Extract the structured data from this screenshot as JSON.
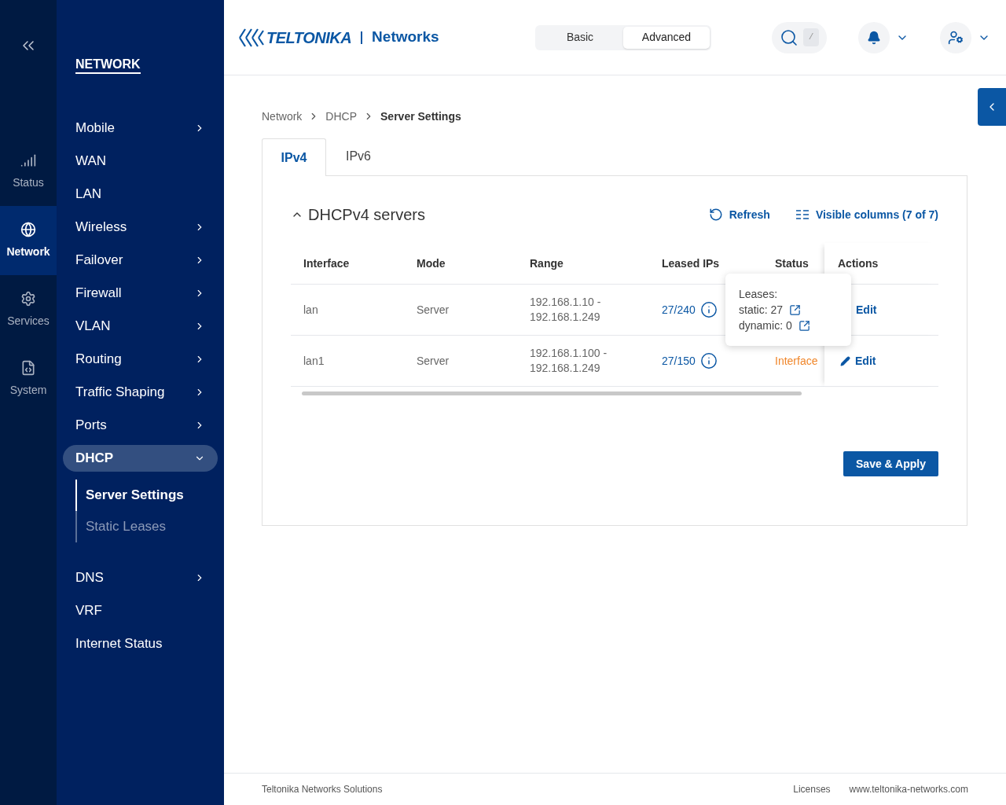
{
  "rail_items": [
    {
      "label": "Status",
      "kind": "signal",
      "selected": false
    },
    {
      "label": "Network",
      "kind": "globe",
      "selected": true
    },
    {
      "label": "Services",
      "kind": "gear",
      "selected": false
    },
    {
      "label": "System",
      "kind": "file",
      "selected": false
    }
  ],
  "nav": {
    "title": "NETWORK",
    "items": [
      {
        "label": "Mobile",
        "kind": "group",
        "expanded": false,
        "selected": false
      },
      {
        "label": "WAN",
        "kind": "link",
        "selected": false
      },
      {
        "label": "LAN",
        "kind": "link",
        "selected": false
      },
      {
        "label": "Wireless",
        "kind": "group",
        "expanded": false,
        "selected": false
      },
      {
        "label": "Failover",
        "kind": "group",
        "expanded": false,
        "selected": false
      },
      {
        "label": "Firewall",
        "kind": "group",
        "expanded": false,
        "selected": false
      },
      {
        "label": "VLAN",
        "kind": "group",
        "expanded": false,
        "selected": false
      },
      {
        "label": "Routing",
        "kind": "group",
        "expanded": false,
        "selected": false
      },
      {
        "label": "Traffic Shaping",
        "kind": "group",
        "expanded": false,
        "selected": false
      },
      {
        "label": "Ports",
        "kind": "group",
        "expanded": false,
        "selected": false
      },
      {
        "label": "DHCP",
        "kind": "group",
        "expanded": true,
        "selected": true,
        "children": [
          {
            "label": "Server Settings",
            "selected": true
          },
          {
            "label": "Static Leases",
            "selected": false
          }
        ]
      },
      {
        "label": "DNS",
        "kind": "group",
        "expanded": false,
        "selected": false
      },
      {
        "label": "VRF",
        "kind": "link",
        "selected": false
      },
      {
        "label": "Internet Status",
        "kind": "link",
        "selected": false
      }
    ]
  },
  "header": {
    "logo": {
      "brand": "TELTONIKA",
      "product": "Networks"
    },
    "mode_switch": [
      {
        "label": "Basic",
        "selected": false
      },
      {
        "label": "Advanced",
        "selected": true
      }
    ],
    "search_shortcut": "/"
  },
  "breadcrumb": [
    "Network",
    "DHCP",
    "Server Settings"
  ],
  "tabs": [
    {
      "label": "IPv4",
      "selected": true
    },
    {
      "label": "IPv6",
      "selected": false
    }
  ],
  "section": {
    "title": "DHCPv4 servers",
    "expanded": true,
    "actions": [
      {
        "label": "Refresh",
        "kind": "refresh"
      },
      {
        "label": "Visible columns (7 of 7)",
        "kind": "columns"
      }
    ]
  },
  "table": {
    "columns": [
      "Interface",
      "Mode",
      "Range",
      "Leased IPs",
      "Status",
      "Actions"
    ],
    "rows": [
      {
        "interface": "lan",
        "mode": "Server",
        "range": [
          "192.168.1.10 -",
          "192.168.1.249"
        ],
        "leased": "27/240",
        "action": "Edit",
        "tooltip": {
          "title": "Leases:",
          "lines": [
            "static: 27",
            "dynamic: 0"
          ]
        }
      },
      {
        "interface": "lan1",
        "mode": "Server",
        "range": [
          "192.168.1.100 -",
          "192.168.1.249"
        ],
        "leased": "27/150",
        "status": "Interface",
        "action": "Edit"
      }
    ]
  },
  "save_button": "Save & Apply",
  "footer": {
    "left": "Teltonika Networks Solutions",
    "links": [
      "Licenses",
      "www.teltonika-networks.com"
    ]
  }
}
